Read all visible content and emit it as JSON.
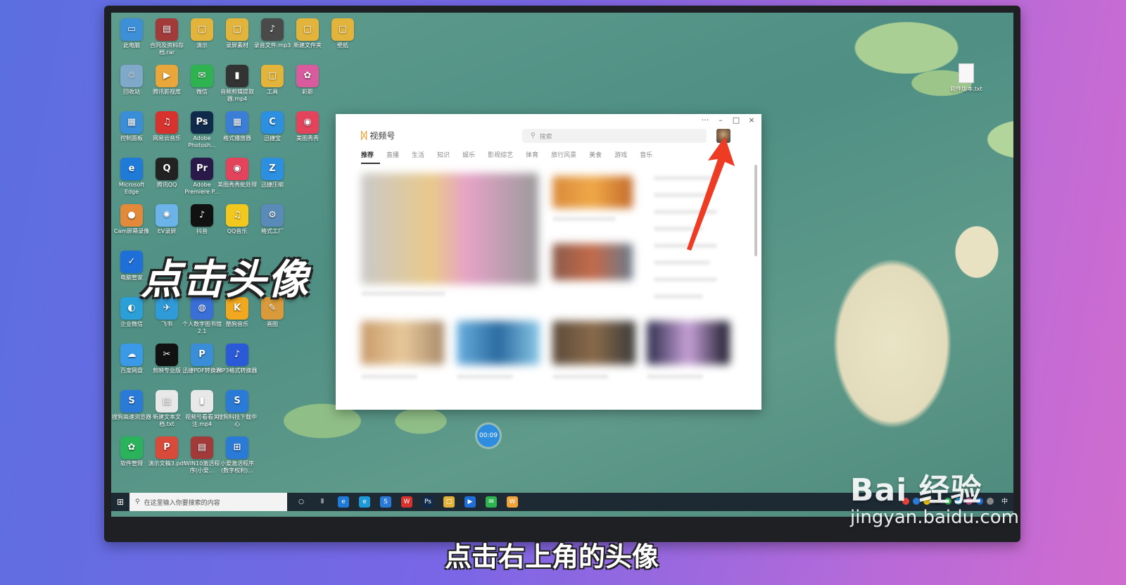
{
  "desktop_icons": [
    {
      "label": "此电脑",
      "glyph": "▭",
      "color": "#3d8fd8"
    },
    {
      "label": "合同及资料存档.rar",
      "glyph": "▤",
      "color": "#a23a3a"
    },
    {
      "label": "演示",
      "glyph": "▢",
      "color": "#e2b43b"
    },
    {
      "label": "录屏素材",
      "glyph": "▢",
      "color": "#e2b43b"
    },
    {
      "label": "录音文件.mp3",
      "glyph": "♪",
      "color": "#4a4a4a"
    },
    {
      "label": "新建文件夹",
      "glyph": "▢",
      "color": "#e2b43b"
    },
    {
      "label": "壁纸",
      "glyph": "▢",
      "color": "#e2b43b"
    },
    {
      "label": "回收站",
      "glyph": "♲",
      "color": "#7fa8c9"
    },
    {
      "label": "腾讯影视库",
      "glyph": "▶",
      "color": "#e9a63a"
    },
    {
      "label": "微信",
      "glyph": "✉",
      "color": "#2fb351"
    },
    {
      "label": "音频剪辑提取器.mp4",
      "glyph": "▮",
      "color": "#333"
    },
    {
      "label": "工具",
      "glyph": "▢",
      "color": "#e2b43b"
    },
    {
      "label": "彩影",
      "glyph": "✿",
      "color": "#d85b9e"
    },
    {
      "label": "控制面板",
      "glyph": "▦",
      "color": "#3a8ed8"
    },
    {
      "label": "网易云音乐",
      "glyph": "♫",
      "color": "#d8322f"
    },
    {
      "label": "Adobe Photosh...",
      "glyph": "Ps",
      "color": "#0f2a4a"
    },
    {
      "label": "格式播放器",
      "glyph": "▦",
      "color": "#3a7ed8"
    },
    {
      "label": "迅捷宝",
      "glyph": "C",
      "color": "#2d8fe0"
    },
    {
      "label": "美图秀秀",
      "glyph": "◉",
      "color": "#e4435c"
    },
    {
      "label": "Microsoft Edge",
      "glyph": "e",
      "color": "#1f7ad8"
    },
    {
      "label": "腾讯QQ",
      "glyph": "Q",
      "color": "#222"
    },
    {
      "label": "Adobe Premiere P...",
      "glyph": "Pr",
      "color": "#2a1a4a"
    },
    {
      "label": "美图秀秀批处理",
      "glyph": "◉",
      "color": "#e4435c"
    },
    {
      "label": "迅捷压缩",
      "glyph": "Z",
      "color": "#2d8fe0"
    },
    {
      "label": "Cam屏幕录像",
      "glyph": "●",
      "color": "#e28a3a"
    },
    {
      "label": "EV录屏",
      "glyph": "✺",
      "color": "#6bb3e8"
    },
    {
      "label": "抖音",
      "glyph": "♪",
      "color": "#111"
    },
    {
      "label": "QQ音乐",
      "glyph": "♫",
      "color": "#f2c81e"
    },
    {
      "label": "格式工厂",
      "glyph": "⚙",
      "color": "#5a8ab8"
    },
    {
      "label": "电脑管家",
      "glyph": "✓",
      "color": "#1f6fd8"
    },
    {
      "label": "企业微信",
      "glyph": "◐",
      "color": "#2a9fd8"
    },
    {
      "label": "飞书",
      "glyph": "✈",
      "color": "#2f9bd8"
    },
    {
      "label": "个人数字图书馆2.1",
      "glyph": "◍",
      "color": "#3a6fd8"
    },
    {
      "label": "酷狗音乐",
      "glyph": "K",
      "color": "#f2a81e"
    },
    {
      "label": "画图",
      "glyph": "✎",
      "color": "#d89a3a"
    },
    {
      "label": "百度网盘",
      "glyph": "☁",
      "color": "#3a9ae8"
    },
    {
      "label": "剪映专业版",
      "glyph": "✂",
      "color": "#111"
    },
    {
      "label": "迅捷PDF转换器",
      "glyph": "P",
      "color": "#3a8ed8"
    },
    {
      "label": "MP3格式转换器",
      "glyph": "♪",
      "color": "#2a5ad8"
    },
    {
      "label": "搜狗高速浏览器",
      "glyph": "S",
      "color": "#2a7ad8"
    },
    {
      "label": "新建文本文档.txt",
      "glyph": "▤",
      "color": "#e8e8e8"
    },
    {
      "label": "视频号看看关注.mp4",
      "glyph": "▮",
      "color": "#e8e8e8"
    },
    {
      "label": "搜狗科技下载中心",
      "glyph": "S",
      "color": "#2a7ad8"
    },
    {
      "label": "软件管理",
      "glyph": "✿",
      "color": "#2ab35a"
    },
    {
      "label": "演示文稿3.pdf",
      "glyph": "P",
      "color": "#d84a3a"
    },
    {
      "label": "WIN10激活程序(小爱...",
      "glyph": "▤",
      "color": "#a23a3a"
    },
    {
      "label": "小爱激活程序(数字权利)...",
      "glyph": "⊞",
      "color": "#2a7ad8"
    }
  ],
  "right_file": {
    "label": "软件版本.txt"
  },
  "overlay_caption": "点击头像",
  "app": {
    "brand": "视频号",
    "search_placeholder": "搜索",
    "tabs": [
      "推荐",
      "直播",
      "生活",
      "知识",
      "娱乐",
      "影视综艺",
      "体育",
      "旅行风景",
      "美食",
      "游戏",
      "音乐"
    ],
    "controls": {
      "more": "···",
      "minimize": "–",
      "maximize": "□",
      "close": "×"
    }
  },
  "timer": "00:09",
  "taskbar": {
    "search_placeholder": "在这里输入你要搜索的内容",
    "pinned": [
      {
        "glyph": "○",
        "color": "transparent"
      },
      {
        "glyph": "⫴",
        "color": "transparent"
      },
      {
        "glyph": "e",
        "color": "#1f7ad8"
      },
      {
        "glyph": "e",
        "color": "#1f9ad8"
      },
      {
        "glyph": "S",
        "color": "#2a7ad8"
      },
      {
        "glyph": "W",
        "color": "#d8322f"
      },
      {
        "glyph": "Ps",
        "color": "#0f2a4a"
      },
      {
        "glyph": "▢",
        "color": "#e2b43b"
      },
      {
        "glyph": "▶",
        "color": "#1f6fd8"
      },
      {
        "glyph": "✉",
        "color": "#2fb351"
      },
      {
        "glyph": "W",
        "color": "#f0a33a"
      }
    ],
    "tray_colors": [
      "#e8433a",
      "#2a7ad8",
      "#f2c81e",
      "#111",
      "#2fb351",
      "#2a9fd8",
      "#d85b9e",
      "#1f6fd8",
      "#888"
    ],
    "ime": "中"
  },
  "subtitle": "点击右上角的头像",
  "watermark": {
    "brand": "Bai 经验",
    "url": "jingyan.baidu.com"
  }
}
